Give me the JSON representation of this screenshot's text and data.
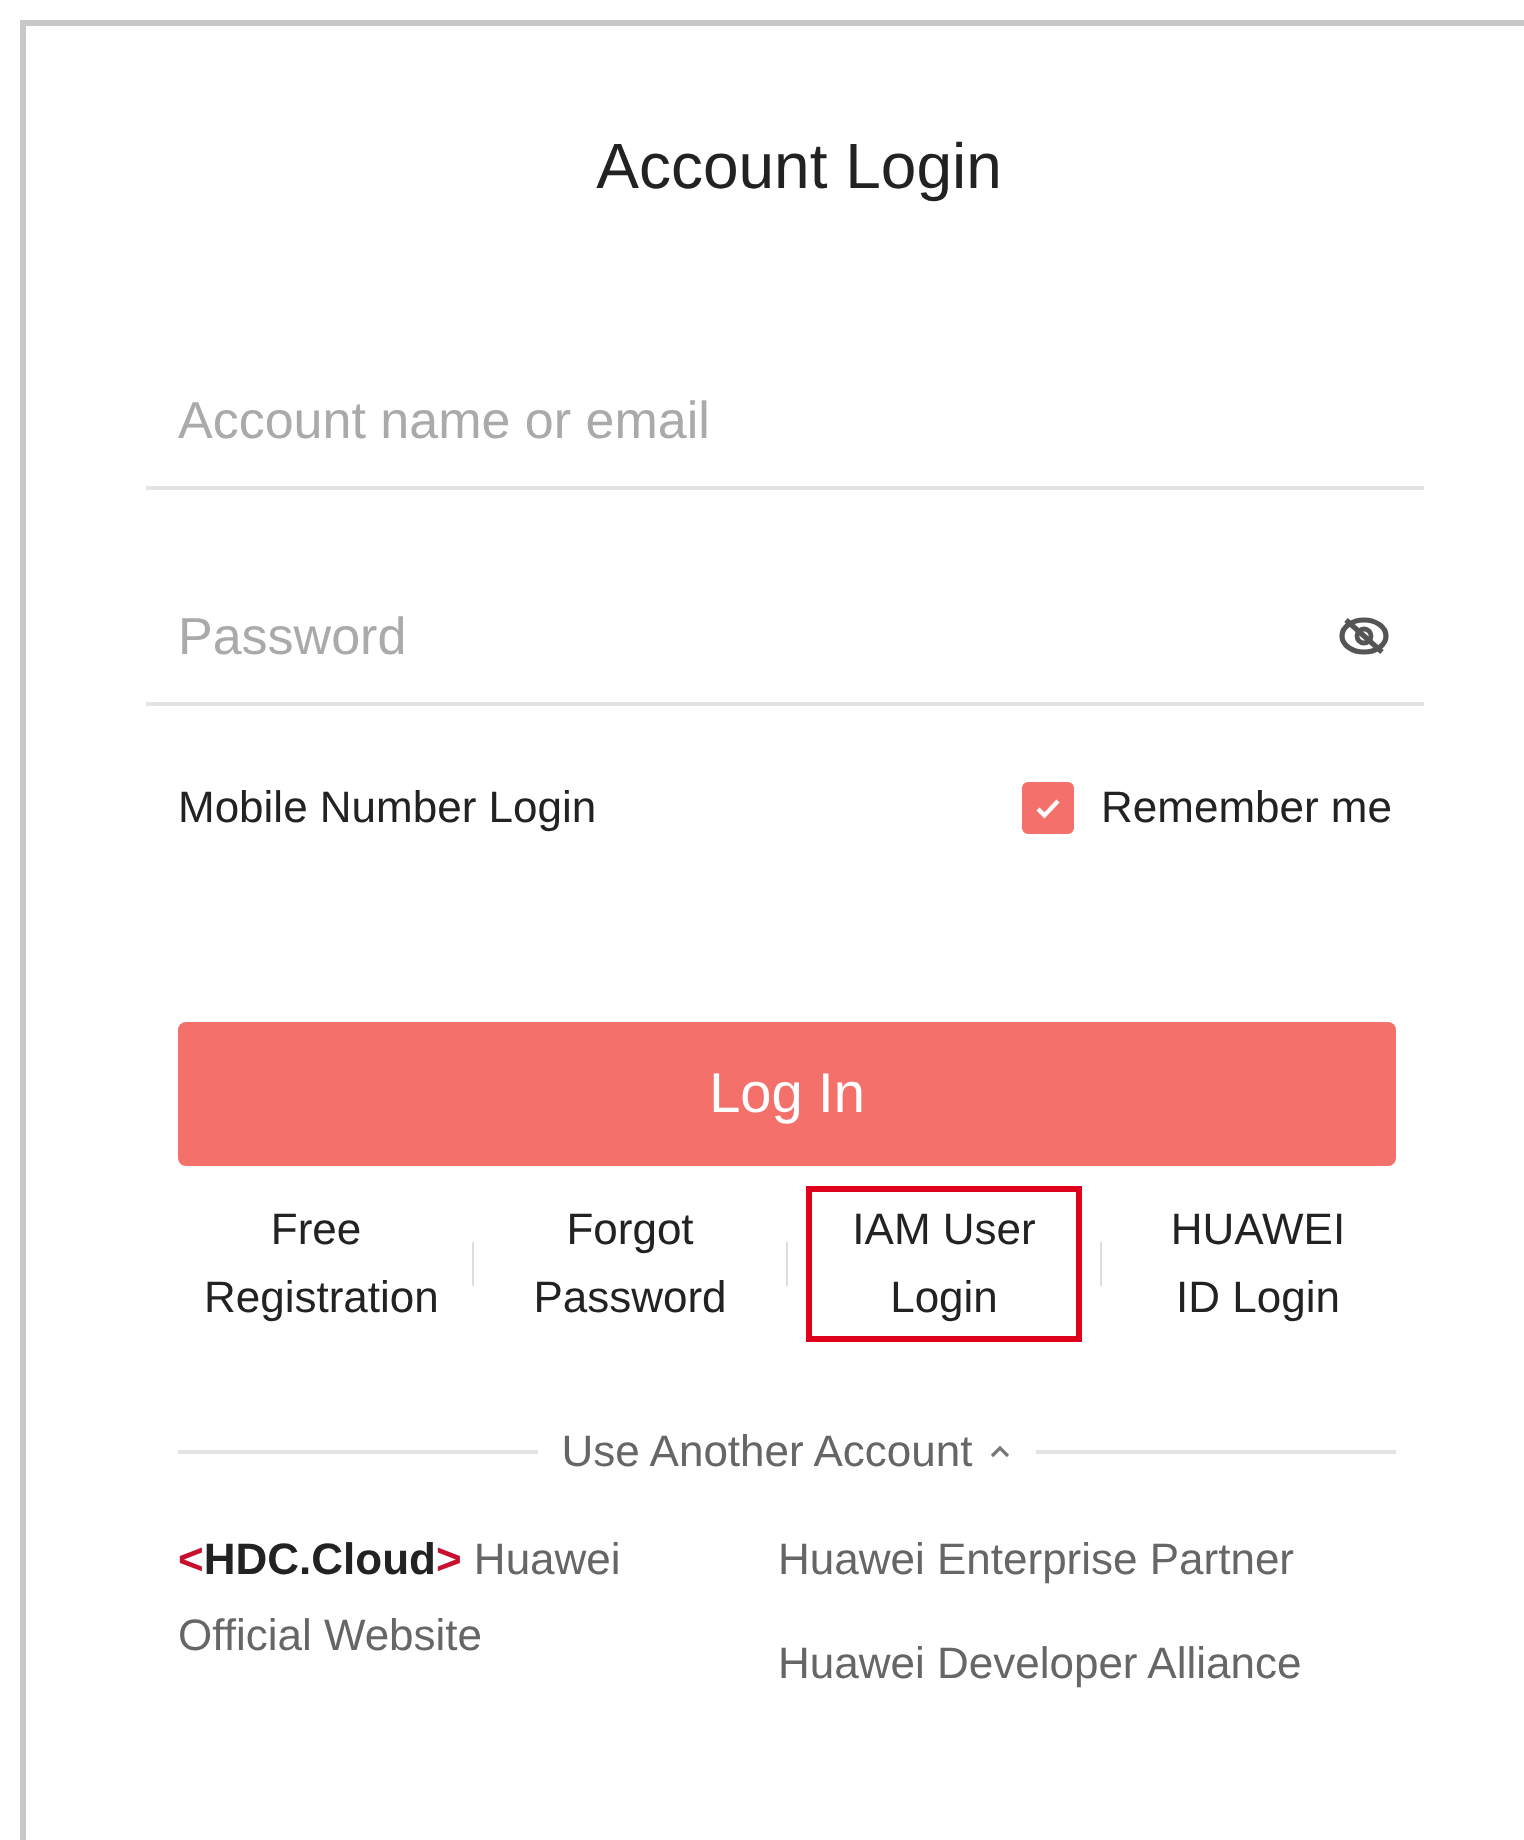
{
  "title": "Account Login",
  "fields": [
    {
      "placeholder": "Account name or email",
      "kind": "text"
    },
    {
      "placeholder": "Password",
      "kind": "password"
    }
  ],
  "mobile_login": "Mobile Number Login",
  "remember": {
    "label": "Remember me",
    "checked": true
  },
  "login_button": "Log In",
  "links": [
    {
      "label": "Free Registration",
      "highlighted": false
    },
    {
      "label": "Forgot Password",
      "highlighted": false
    },
    {
      "label": "IAM User Login",
      "highlighted": true
    },
    {
      "label": "HUAWEI ID Login",
      "highlighted": false
    }
  ],
  "another_account": {
    "label": "Use Another Account",
    "expanded": true
  },
  "other_accounts": [
    {
      "kind": "logo",
      "logo": {
        "open": "<",
        "name": "HDC.Cloud",
        "close": ">"
      },
      "label": "Huawei Official Website"
    },
    {
      "kind": "text",
      "label": "Huawei Enterprise Partner"
    },
    {
      "kind": "text",
      "label": "Huawei Developer Alliance"
    }
  ]
}
